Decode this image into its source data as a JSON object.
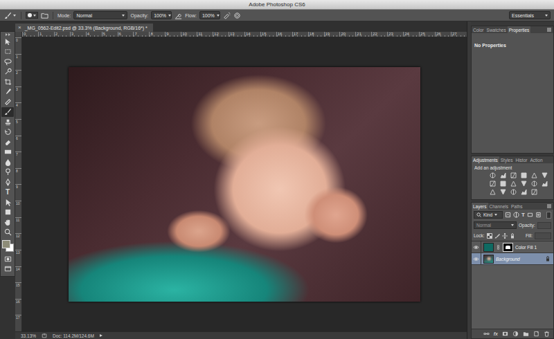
{
  "window": {
    "title": "Adobe Photoshop CS6"
  },
  "options_bar": {
    "mode_label": "Mode:",
    "mode": "Normal",
    "opacity_label": "Opacity:",
    "opacity": "100%",
    "flow_label": "Flow:",
    "flow": "100%",
    "workspace": "Essentials"
  },
  "tools": [
    {
      "kind": "move",
      "selected": false
    },
    {
      "kind": "marquee",
      "selected": false
    },
    {
      "kind": "lasso",
      "selected": false
    },
    {
      "kind": "quick-select",
      "selected": false
    },
    {
      "kind": "crop",
      "selected": false
    },
    {
      "kind": "eyedropper",
      "selected": false
    },
    {
      "kind": "healing",
      "selected": false
    },
    {
      "kind": "brush",
      "selected": true
    },
    {
      "kind": "stamp",
      "selected": false
    },
    {
      "kind": "history-brush",
      "selected": false
    },
    {
      "kind": "eraser",
      "selected": false
    },
    {
      "kind": "gradient",
      "selected": false
    },
    {
      "kind": "blur",
      "selected": false
    },
    {
      "kind": "dodge",
      "selected": false
    },
    {
      "kind": "pen",
      "selected": false
    },
    {
      "kind": "type",
      "glyph": "T",
      "selected": false
    },
    {
      "kind": "path-select",
      "selected": false
    },
    {
      "kind": "rectangle",
      "selected": false
    },
    {
      "kind": "hand",
      "selected": false
    },
    {
      "kind": "zoom",
      "selected": false
    }
  ],
  "document_tab": {
    "close": "×",
    "title": "_MG_0562-Edit2.psd @ 33.3% (Background, RGB/16*) *",
    "selected": true
  },
  "rulers": {
    "horizontal": [
      "0",
      "1",
      "2",
      "3",
      "4",
      "5",
      "6",
      "7",
      "8",
      "9",
      "10",
      "11",
      "12",
      "13",
      "14",
      "15",
      "16",
      "17",
      "18",
      "19",
      "20",
      "21",
      "22",
      "23",
      "24",
      "25",
      "26",
      "27"
    ],
    "vertical": [
      "0",
      "1",
      "2",
      "3",
      "4",
      "5",
      "6",
      "7",
      "8",
      "9",
      "10",
      "11",
      "12",
      "13",
      "14",
      "15",
      "16",
      "17"
    ]
  },
  "status_bar": {
    "zoom": "33.13%",
    "doc": "Doc: 114.2M/124.6M"
  },
  "properties_panel": {
    "tabs": [
      {
        "label": "Color",
        "selected": false
      },
      {
        "label": "Swatches",
        "selected": false
      },
      {
        "label": "Properties",
        "selected": true
      }
    ],
    "message": "No Properties"
  },
  "adjustments_panel": {
    "tabs": [
      {
        "label": "Adjustments",
        "selected": true
      },
      {
        "label": "Styles",
        "selected": false
      },
      {
        "label": "Histor",
        "selected": false
      },
      {
        "label": "Action",
        "selected": false
      }
    ],
    "heading": "Add an adjustment"
  },
  "layers_panel": {
    "tabs": [
      {
        "label": "Layers",
        "selected": true
      },
      {
        "label": "Channels",
        "selected": false
      },
      {
        "label": "Paths",
        "selected": false
      }
    ],
    "filter": "Kind",
    "filter_icons": [
      {
        "kind": "pixel"
      },
      {
        "kind": "adjustment"
      },
      {
        "kind": "type",
        "glyph": "T"
      },
      {
        "kind": "shape"
      },
      {
        "kind": "smart"
      }
    ],
    "blend_mode": "Normal",
    "opacity_label": "Opacity:",
    "controls_disabled": true,
    "lock_label": "Lock:",
    "fill_label": "Fill:",
    "layers": [
      {
        "name": "Color Fill 1",
        "kind": "fill",
        "color": "#0f6a62",
        "visible": true,
        "selected": false,
        "locked": false
      },
      {
        "name": "Background",
        "kind": "image",
        "visible": true,
        "selected": true,
        "locked": true
      }
    ],
    "fx_label": "fx"
  }
}
